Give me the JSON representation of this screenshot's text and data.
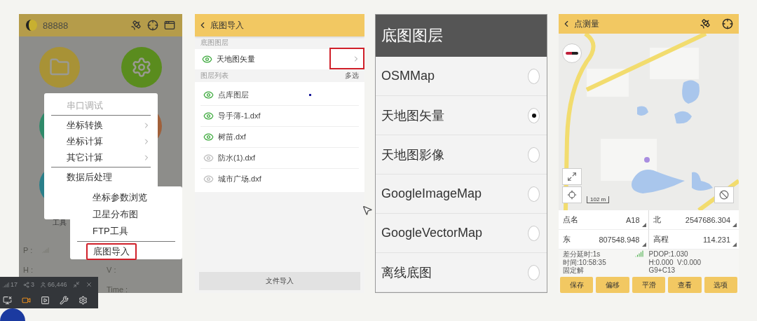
{
  "main_screen": {
    "header": {
      "title": "88888"
    },
    "menu": {
      "groups": [
        [
          {
            "label": "串口调试",
            "disabled": true,
            "submenu": false
          }
        ],
        [
          {
            "label": "坐标转换",
            "disabled": false,
            "submenu": true
          },
          {
            "label": "坐标计算",
            "disabled": false,
            "submenu": true
          },
          {
            "label": "其它计算",
            "disabled": false,
            "submenu": true
          }
        ],
        [
          {
            "label": "数据后处理",
            "disabled": false,
            "submenu": false
          }
        ]
      ]
    },
    "submenu": {
      "groups": [
        [
          {
            "label": "坐标参数浏览",
            "highlighted": false
          },
          {
            "label": "卫星分布图",
            "highlighted": false
          },
          {
            "label": "FTP工具",
            "highlighted": false
          }
        ],
        [
          {
            "label": "底图导入",
            "highlighted": true
          }
        ]
      ]
    },
    "tool_label": "工具",
    "status_labels": [
      "P :",
      "H :",
      "V :",
      "Time :"
    ]
  },
  "import_screen": {
    "title": "底图导入",
    "base_section": "底图图层",
    "base_layer": {
      "name": "天地图矢量",
      "visible": true,
      "highlighted": true
    },
    "list_section": "图层列表",
    "multi_select": "多选",
    "layers": [
      {
        "name": "点库图层",
        "visible": true
      },
      {
        "name": "导手薄-1.dxf",
        "visible": true
      },
      {
        "name": "树苗.dxf",
        "visible": true
      },
      {
        "name": "防水(1).dxf",
        "visible": false
      },
      {
        "name": "城市广场.dxf",
        "visible": false
      }
    ],
    "import_button": "文件导入"
  },
  "layer_dialog": {
    "title": "底图图层",
    "options": [
      {
        "label": "OSMMap",
        "selected": false
      },
      {
        "label": "天地图矢量",
        "selected": true
      },
      {
        "label": "天地图影像",
        "selected": false
      },
      {
        "label": "GoogleImageMap",
        "selected": false
      },
      {
        "label": "GoogleVectorMap",
        "selected": false
      },
      {
        "label": "离线底图",
        "selected": false
      }
    ]
  },
  "survey_screen": {
    "title": "点测量",
    "scale": "102 m",
    "fields": [
      {
        "label": "点名",
        "value": "A18"
      },
      {
        "label": "北",
        "value": "2547686.304"
      },
      {
        "label": "东",
        "value": "807548.948"
      },
      {
        "label": "高程",
        "value": "114.231"
      }
    ],
    "status_left": [
      "差分延时:1s",
      "时间:10:58:35",
      "固定解"
    ],
    "status_right": [
      "PDOP:1.030",
      "H:0.000  V:0.000",
      "G9+C13"
    ],
    "buttons": [
      "保存",
      "偏移",
      "平滑",
      "查看",
      "选项"
    ]
  },
  "recorder_toolbar": {
    "stats": [
      "17",
      "3",
      "66,446"
    ],
    "tools": [
      {
        "selected": false
      },
      {
        "selected": true
      },
      {
        "selected": false
      },
      {
        "selected": false
      },
      {
        "selected": false
      }
    ]
  }
}
